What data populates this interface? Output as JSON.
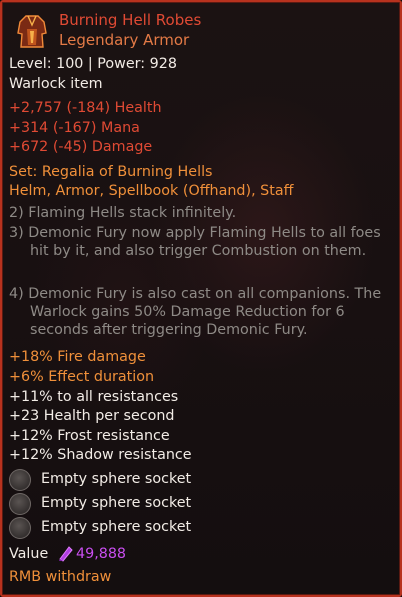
{
  "item": {
    "name": "Burning Hell Robes",
    "rarity_type": "Legendary Armor",
    "level_power": "Level: 100 | Power: 928",
    "class_item": "Warlock item",
    "icon": "robe-icon"
  },
  "stats": [
    {
      "value": "+2,757",
      "delta": "(-184)",
      "label": "Health"
    },
    {
      "value": "+314",
      "delta": "(-167)",
      "label": "Mana"
    },
    {
      "value": "+672",
      "delta": "(-45)",
      "label": "Damage"
    }
  ],
  "set": {
    "title": "Set: Regalia of Burning Hells",
    "pieces": "Helm, Armor, Spellbook (Offhand), Staff",
    "bonuses": [
      "2) Flaming Hells stack infinitely.",
      "3) Demonic Fury now apply Flaming Hells to all foes hit by it, and also trigger Combustion on them.",
      "4) Demonic Fury is also cast on all companions. The Warlock gains 50% Damage Reduction for 6 seconds after triggering Demonic Fury."
    ]
  },
  "legendary_affixes": [
    "+18% Fire damage",
    "+6% Effect duration"
  ],
  "affixes": [
    "+11% to all resistances",
    "+23 Health per second",
    "+12% Frost resistance",
    "+12% Shadow resistance"
  ],
  "sockets": [
    "Empty sphere socket",
    "Empty sphere socket",
    "Empty sphere socket"
  ],
  "value": {
    "label": "Value",
    "amount": "49,888",
    "icon": "gem-icon"
  },
  "action_hint": "RMB withdraw",
  "colors": {
    "border": "#b8321e",
    "title": "#e04a34",
    "legendary": "#f0903a",
    "text": "#f2ece6",
    "inactive_bonus": "#8e8a86",
    "currency": "#c94ef0"
  }
}
